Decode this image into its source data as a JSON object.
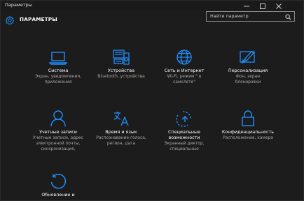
{
  "window": {
    "title": "Параметры"
  },
  "header": {
    "title": "ПАРАМЕТРЫ",
    "search_placeholder": "Найти параметр"
  },
  "accent": "#1f8fff",
  "tiles": [
    {
      "icon": "laptop-icon",
      "name": "Система",
      "desc": [
        "Экран, уведомления,",
        "приложения"
      ]
    },
    {
      "icon": "devices-icon",
      "name": "Устройства",
      "desc": [
        "Bluetooth, устройства"
      ]
    },
    {
      "icon": "globe-icon",
      "name": "Сеть и Интернет",
      "desc": [
        "Wi-Fi, режим \" в",
        "самолете\""
      ]
    },
    {
      "icon": "paintbrush-icon",
      "name": "Персонализация",
      "desc": [
        "Фон, экран",
        "блокировки"
      ]
    },
    {
      "icon": "person-icon",
      "name": "Учетные записи",
      "desc": [
        "Учетные записи, адрес",
        "электронной почты,",
        "синхронизация,"
      ]
    },
    {
      "icon": "language-icon",
      "name": "Время и язык",
      "desc": [
        "Распознавание голоса,",
        "регион, дата"
      ]
    },
    {
      "icon": "ease-of-access-icon",
      "name": "Специальные",
      "name2": "возможности",
      "desc": [
        "Экранный диктор,",
        "специальные"
      ]
    },
    {
      "icon": "lock-icon",
      "name": "Конфиденциальность",
      "desc": [
        "Расположение, камера"
      ]
    },
    {
      "icon": "update-icon",
      "name": "Обновление и",
      "desc": []
    }
  ]
}
